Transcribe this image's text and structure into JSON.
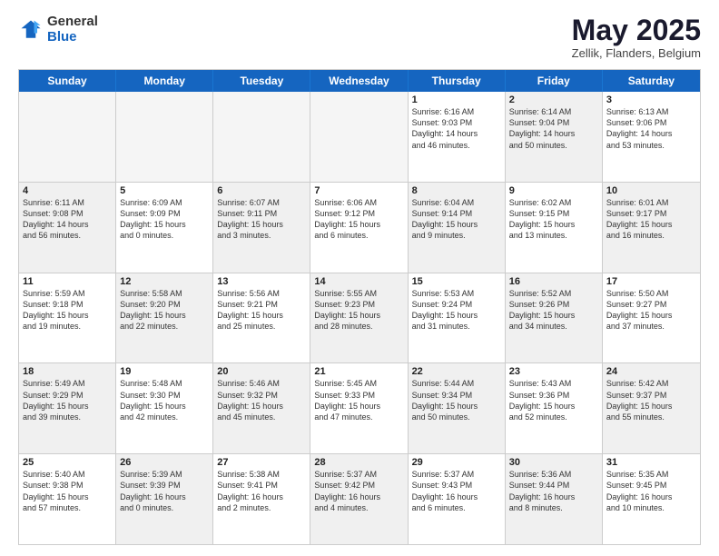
{
  "logo": {
    "general": "General",
    "blue": "Blue"
  },
  "header": {
    "month": "May 2025",
    "location": "Zellik, Flanders, Belgium"
  },
  "weekdays": [
    "Sunday",
    "Monday",
    "Tuesday",
    "Wednesday",
    "Thursday",
    "Friday",
    "Saturday"
  ],
  "rows": [
    [
      {
        "day": "",
        "text": "",
        "empty": true
      },
      {
        "day": "",
        "text": "",
        "empty": true
      },
      {
        "day": "",
        "text": "",
        "empty": true
      },
      {
        "day": "",
        "text": "",
        "empty": true
      },
      {
        "day": "1",
        "text": "Sunrise: 6:16 AM\nSunset: 9:03 PM\nDaylight: 14 hours\nand 46 minutes."
      },
      {
        "day": "2",
        "text": "Sunrise: 6:14 AM\nSunset: 9:04 PM\nDaylight: 14 hours\nand 50 minutes.",
        "shaded": true
      },
      {
        "day": "3",
        "text": "Sunrise: 6:13 AM\nSunset: 9:06 PM\nDaylight: 14 hours\nand 53 minutes."
      }
    ],
    [
      {
        "day": "4",
        "text": "Sunrise: 6:11 AM\nSunset: 9:08 PM\nDaylight: 14 hours\nand 56 minutes.",
        "shaded": true
      },
      {
        "day": "5",
        "text": "Sunrise: 6:09 AM\nSunset: 9:09 PM\nDaylight: 15 hours\nand 0 minutes."
      },
      {
        "day": "6",
        "text": "Sunrise: 6:07 AM\nSunset: 9:11 PM\nDaylight: 15 hours\nand 3 minutes.",
        "shaded": true
      },
      {
        "day": "7",
        "text": "Sunrise: 6:06 AM\nSunset: 9:12 PM\nDaylight: 15 hours\nand 6 minutes."
      },
      {
        "day": "8",
        "text": "Sunrise: 6:04 AM\nSunset: 9:14 PM\nDaylight: 15 hours\nand 9 minutes.",
        "shaded": true
      },
      {
        "day": "9",
        "text": "Sunrise: 6:02 AM\nSunset: 9:15 PM\nDaylight: 15 hours\nand 13 minutes."
      },
      {
        "day": "10",
        "text": "Sunrise: 6:01 AM\nSunset: 9:17 PM\nDaylight: 15 hours\nand 16 minutes.",
        "shaded": true
      }
    ],
    [
      {
        "day": "11",
        "text": "Sunrise: 5:59 AM\nSunset: 9:18 PM\nDaylight: 15 hours\nand 19 minutes."
      },
      {
        "day": "12",
        "text": "Sunrise: 5:58 AM\nSunset: 9:20 PM\nDaylight: 15 hours\nand 22 minutes.",
        "shaded": true
      },
      {
        "day": "13",
        "text": "Sunrise: 5:56 AM\nSunset: 9:21 PM\nDaylight: 15 hours\nand 25 minutes."
      },
      {
        "day": "14",
        "text": "Sunrise: 5:55 AM\nSunset: 9:23 PM\nDaylight: 15 hours\nand 28 minutes.",
        "shaded": true
      },
      {
        "day": "15",
        "text": "Sunrise: 5:53 AM\nSunset: 9:24 PM\nDaylight: 15 hours\nand 31 minutes."
      },
      {
        "day": "16",
        "text": "Sunrise: 5:52 AM\nSunset: 9:26 PM\nDaylight: 15 hours\nand 34 minutes.",
        "shaded": true
      },
      {
        "day": "17",
        "text": "Sunrise: 5:50 AM\nSunset: 9:27 PM\nDaylight: 15 hours\nand 37 minutes."
      }
    ],
    [
      {
        "day": "18",
        "text": "Sunrise: 5:49 AM\nSunset: 9:29 PM\nDaylight: 15 hours\nand 39 minutes.",
        "shaded": true
      },
      {
        "day": "19",
        "text": "Sunrise: 5:48 AM\nSunset: 9:30 PM\nDaylight: 15 hours\nand 42 minutes."
      },
      {
        "day": "20",
        "text": "Sunrise: 5:46 AM\nSunset: 9:32 PM\nDaylight: 15 hours\nand 45 minutes.",
        "shaded": true
      },
      {
        "day": "21",
        "text": "Sunrise: 5:45 AM\nSunset: 9:33 PM\nDaylight: 15 hours\nand 47 minutes."
      },
      {
        "day": "22",
        "text": "Sunrise: 5:44 AM\nSunset: 9:34 PM\nDaylight: 15 hours\nand 50 minutes.",
        "shaded": true
      },
      {
        "day": "23",
        "text": "Sunrise: 5:43 AM\nSunset: 9:36 PM\nDaylight: 15 hours\nand 52 minutes."
      },
      {
        "day": "24",
        "text": "Sunrise: 5:42 AM\nSunset: 9:37 PM\nDaylight: 15 hours\nand 55 minutes.",
        "shaded": true
      }
    ],
    [
      {
        "day": "25",
        "text": "Sunrise: 5:40 AM\nSunset: 9:38 PM\nDaylight: 15 hours\nand 57 minutes."
      },
      {
        "day": "26",
        "text": "Sunrise: 5:39 AM\nSunset: 9:39 PM\nDaylight: 16 hours\nand 0 minutes.",
        "shaded": true
      },
      {
        "day": "27",
        "text": "Sunrise: 5:38 AM\nSunset: 9:41 PM\nDaylight: 16 hours\nand 2 minutes."
      },
      {
        "day": "28",
        "text": "Sunrise: 5:37 AM\nSunset: 9:42 PM\nDaylight: 16 hours\nand 4 minutes.",
        "shaded": true
      },
      {
        "day": "29",
        "text": "Sunrise: 5:37 AM\nSunset: 9:43 PM\nDaylight: 16 hours\nand 6 minutes."
      },
      {
        "day": "30",
        "text": "Sunrise: 5:36 AM\nSunset: 9:44 PM\nDaylight: 16 hours\nand 8 minutes.",
        "shaded": true
      },
      {
        "day": "31",
        "text": "Sunrise: 5:35 AM\nSunset: 9:45 PM\nDaylight: 16 hours\nand 10 minutes."
      }
    ]
  ]
}
